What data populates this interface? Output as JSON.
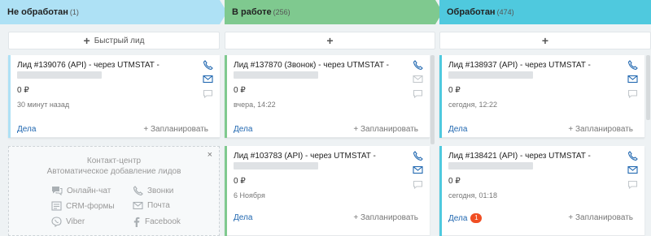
{
  "columns": [
    {
      "stage": {
        "name": "Не обработан",
        "count": "(1)",
        "color": "#aee1f5"
      },
      "add_label": "Быстрый лид",
      "cards": [
        {
          "title": "Лид #139076 (API) - через UTMSTAT -",
          "price": "0 ₽",
          "date": "30 минут назад",
          "deals": "Дела",
          "plan": "+ Запланировать"
        }
      ],
      "contact_center": {
        "close": "×",
        "heading": "Контакт-центр",
        "subheading": "Автоматическое добавление лидов",
        "options": {
          "chat": "Онлайн-чат",
          "calls": "Звонки",
          "crm_forms": "CRM-формы",
          "mail": "Почта",
          "viber": "Viber",
          "facebook": "Facebook"
        }
      }
    },
    {
      "stage": {
        "name": "В работе",
        "count": "(256)",
        "color": "#7fc98f"
      },
      "add_label": "+",
      "cards": [
        {
          "title": "Лид #137870 (Звонок) - через UTMSTAT -",
          "price": "0 ₽",
          "date": "вчера, 14:22",
          "deals": "Дела",
          "plan": "+ Запланировать"
        },
        {
          "title": "Лид #103783 (API) - через UTMSTAT -",
          "price": "0 ₽",
          "date": "6 Ноября",
          "deals": "Дела",
          "plan": "+ Запланировать"
        }
      ]
    },
    {
      "stage": {
        "name": "Обработан",
        "count": "(474)",
        "color": "#4fc9de"
      },
      "add_label": "+",
      "cards": [
        {
          "title": "Лид #138937 (API) - через UTMSTAT -",
          "price": "0 ₽",
          "date": "сегодня, 12:22",
          "deals": "Дела",
          "plan": "+ Запланировать"
        },
        {
          "title": "Лид #138421 (API) - через UTMSTAT -",
          "price": "0 ₽",
          "date": "сегодня, 01:18",
          "deals": "Дела",
          "deals_badge": "1",
          "plan": "+ Запланировать"
        }
      ]
    }
  ],
  "colors": {
    "link": "#2067b0",
    "badge": "#f04e23",
    "icon_active": "#2067b0",
    "icon_muted": "#c4c9cd"
  }
}
